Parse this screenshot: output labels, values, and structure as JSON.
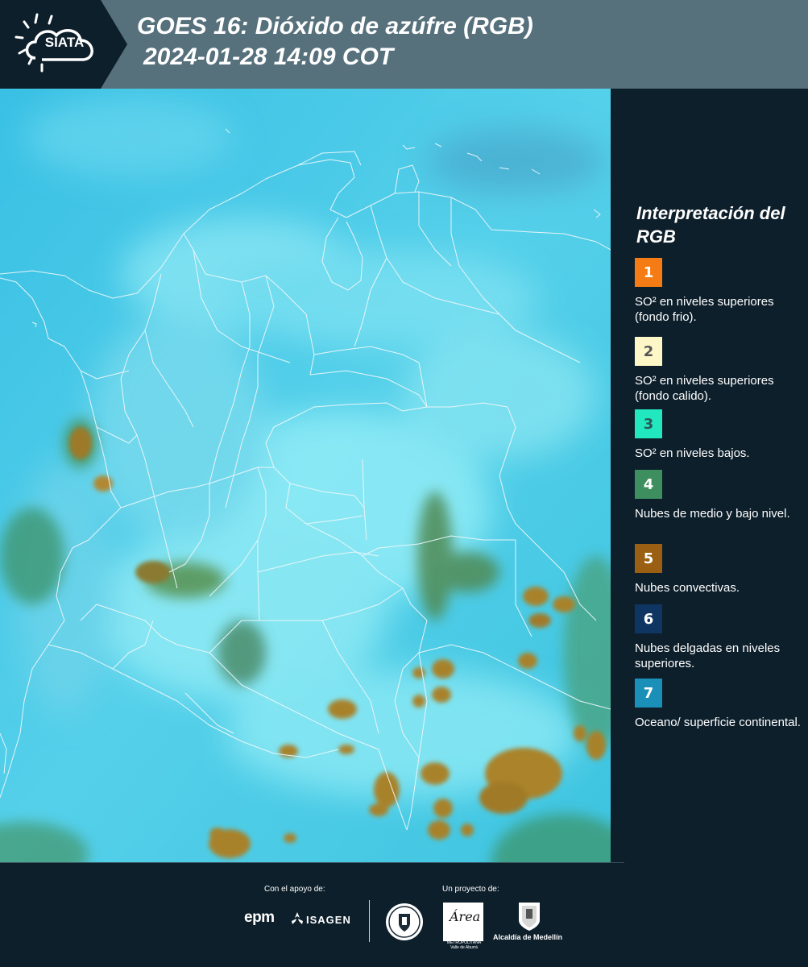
{
  "header": {
    "logo_text": "SIATA",
    "title_line1": "GOES 16: Dióxido de azúfre (RGB)",
    "title_line2": "2024-01-28 14:09 COT"
  },
  "legend": {
    "title": "Interpretación del RGB",
    "items": [
      {
        "number": "1",
        "label": "SO² en niveles superiores (fondo frio).",
        "color": "#f57c14",
        "text_color": "#ffffff"
      },
      {
        "number": "2",
        "label": "SO² en niveles superiores (fondo calido).",
        "color": "#fdf6c7",
        "text_color": "#555555"
      },
      {
        "number": "3",
        "label": "SO² en niveles bajos.",
        "color": "#22e8c0",
        "text_color": "#2a5a5a"
      },
      {
        "number": "4",
        "label": "Nubes de medio y bajo nivel.",
        "color": "#3d8f5f",
        "text_color": "#ffffff"
      },
      {
        "number": "5",
        "label": "Nubes convectivas.",
        "color": "#9a5f12",
        "text_color": "#ffffff"
      },
      {
        "number": "6",
        "label": "Nubes delgadas en niveles superiores.",
        "color": "#0f3563",
        "text_color": "#ffffff"
      },
      {
        "number": "7",
        "label": "Oceano/ superficie continental.",
        "color": "#1a8fb8",
        "text_color": "#ffffff"
      }
    ]
  },
  "footer": {
    "support_label": "Con el apoyo de:",
    "project_label": "Un proyecto de:",
    "epm": "epm",
    "isagen": "ISAGEN",
    "area_word": "Área",
    "area_sub": "METROPOLITANA Valle de Aburrá",
    "alcaldia": "Alcaldía de Medellín"
  },
  "colors": {
    "header_bg": "#56707c",
    "panel_bg": "#0d1f2b",
    "map_base": "#3fc6e6",
    "map_bright": "#88ecf6",
    "cloud_brown": "#a8822c",
    "cloud_green": "#4e8a4a",
    "border_lines": "#e6f2f6"
  }
}
